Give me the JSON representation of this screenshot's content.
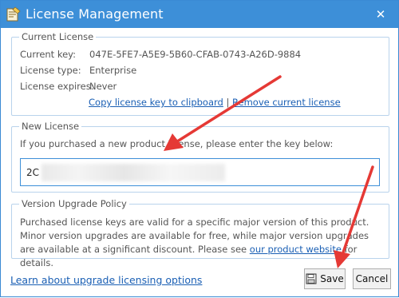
{
  "window": {
    "title": "License Management",
    "close_symbol": "✕",
    "app_icon": "license-app-icon",
    "accent": "#3d8fd8"
  },
  "current_license": {
    "title": "Current License",
    "key_label": "Current key:",
    "key_value": "047E-5FE7-A5E9-5B60-CFAB-0743-A26D-9884",
    "type_label": "License type:",
    "type_value": "Enterprise",
    "expires_label": "License expires:",
    "expires_value": "Never",
    "copy_link": "Copy license key to clipboard",
    "separator": "|",
    "remove_link": "Remove current license"
  },
  "new_license": {
    "title": "New License",
    "prompt": "If you purchased a new product license, please enter the key below:",
    "key_input_value": "2C"
  },
  "upgrade_policy": {
    "title": "Version Upgrade Policy",
    "text_before_link": "Purchased license keys are valid for a specific major version of this product. Minor version upgrades are available for free, while major version upgrades are available at a significant discount. Please see ",
    "link": "our product website",
    "text_after_link": " for details."
  },
  "footer": {
    "learn_link": "Learn about upgrade licensing options",
    "save_label": "Save",
    "cancel_label": "Cancel"
  },
  "annotations": {
    "arrow_color": "#e53935"
  }
}
